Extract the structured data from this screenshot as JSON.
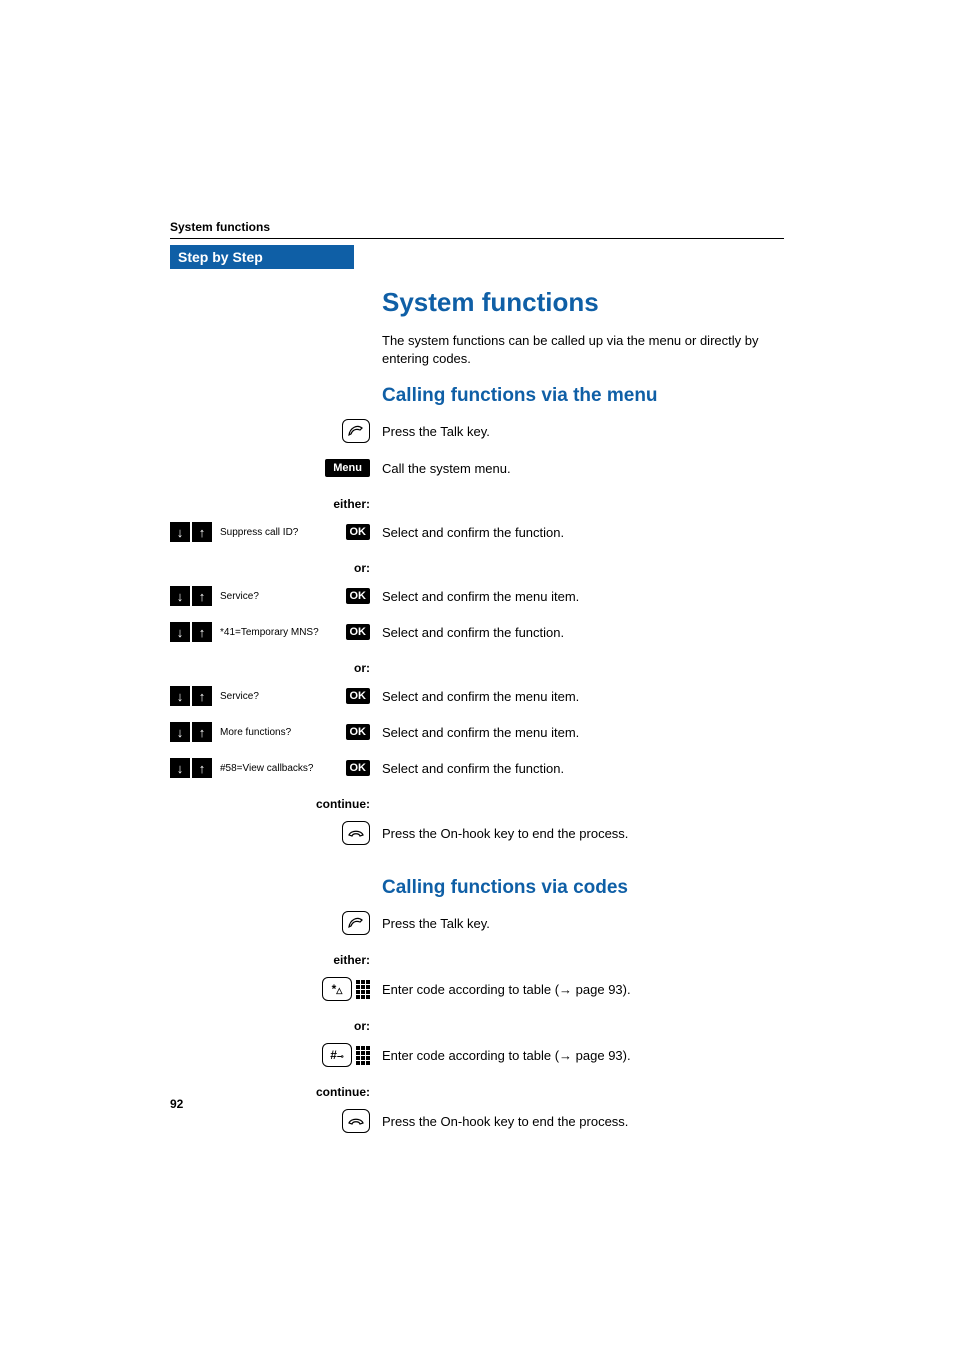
{
  "header": {
    "running": "System functions",
    "step_by_step": "Step by Step"
  },
  "title": "System functions",
  "intro": "The system functions can be called up via the menu or directly by entering codes.",
  "section1": {
    "heading": "Calling functions via the menu",
    "talk": {
      "desc": "Press the Talk key."
    },
    "menu": {
      "label": "Menu",
      "desc": "Call the system menu."
    },
    "either": "either:",
    "or": "or:",
    "continue": "continue:",
    "ok": "OK",
    "items": [
      {
        "label": "Suppress call ID?",
        "desc": "Select and confirm the function."
      },
      {
        "label": "Service?",
        "desc": "Select and confirm the menu item."
      },
      {
        "label": "*41=Temporary MNS?",
        "desc": "Select and confirm the function."
      },
      {
        "label": "Service?",
        "desc": "Select and confirm the menu item."
      },
      {
        "label": "More functions?",
        "desc": "Select and confirm the menu item."
      },
      {
        "label": "#58=View callbacks?",
        "desc": "Select and confirm the function."
      }
    ],
    "end": "Press the On-hook key to end the process."
  },
  "section2": {
    "heading": "Calling functions via codes",
    "talk": {
      "desc": "Press the Talk key."
    },
    "either": "either:",
    "or": "or:",
    "continue": "continue:",
    "star_key": "*",
    "hash_key": "#",
    "code_star": "Enter code according to table (→ page 93).",
    "code_hash": "Enter code according to table (→ page 93).",
    "end": "Press the On-hook key to end the process."
  },
  "page_number": "92",
  "icons": {
    "talk": "talk",
    "onhook": "onhook"
  }
}
